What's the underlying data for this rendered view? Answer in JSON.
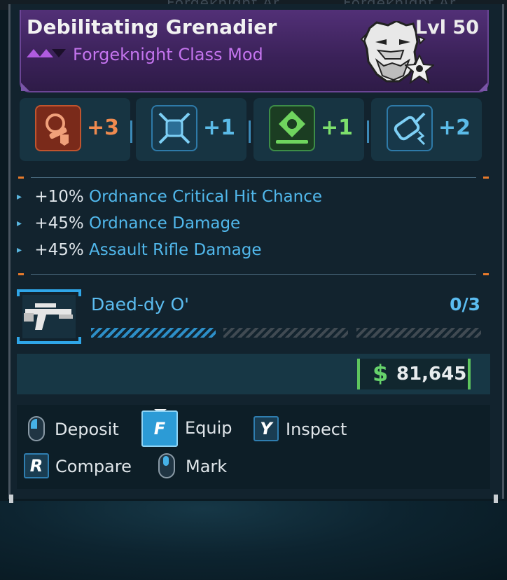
{
  "background_tabs": [
    "Forgeknight Ar",
    "Forgeknight Ar"
  ],
  "item": {
    "name": "Debilitating Grenadier",
    "type": "Forgeknight Class Mod",
    "level": "Lvl 50",
    "rarity_color": "#c474ee",
    "portrait_icon": "bearded-man-portrait-icon",
    "class_badge_icon": "class-emblem-icon"
  },
  "skills": [
    {
      "bonus": "+3",
      "icon": "fire-grenade-skill-icon",
      "color": "#ef8a4f",
      "box_color": "#7a2a1a",
      "border": "#b54a2a"
    },
    {
      "bonus": "+1",
      "icon": "crossed-swords-skill-icon",
      "color": "#5bbbe8",
      "box_color": "#17384a",
      "border": "#2e7aa8"
    },
    {
      "bonus": "+1",
      "icon": "shield-drone-skill-icon",
      "color": "#7ddf6c",
      "box_color": "#1b3d22",
      "border": "#3d8d47"
    },
    {
      "bonus": "+2",
      "icon": "lightning-grenade-skill-icon",
      "color": "#5bbbe8",
      "box_color": "#17384a",
      "border": "#2e7aa8"
    }
  ],
  "stats": [
    {
      "value": "+10%",
      "name": "Ordnance Critical Hit Chance"
    },
    {
      "value": "+45%",
      "name": "Ordnance Damage"
    },
    {
      "value": "+45%",
      "name": "Assault Rifle Damage"
    }
  ],
  "weapon": {
    "name": "Daed-dy O'",
    "count": "0/3",
    "progress_segments_filled": 1,
    "progress_segments_total": 3,
    "icon": "pistol-icon"
  },
  "price": {
    "currency_symbol": "$",
    "amount": "81,645",
    "color": "#5ec55e"
  },
  "actions": [
    {
      "label": "Deposit",
      "input": "mouse-left-icon"
    },
    {
      "label": "Equip",
      "key": "F"
    },
    {
      "label": "Inspect",
      "key": "Y"
    },
    {
      "label": "Compare",
      "key": "R"
    },
    {
      "label": "Mark",
      "input": "mouse-middle-icon"
    }
  ]
}
